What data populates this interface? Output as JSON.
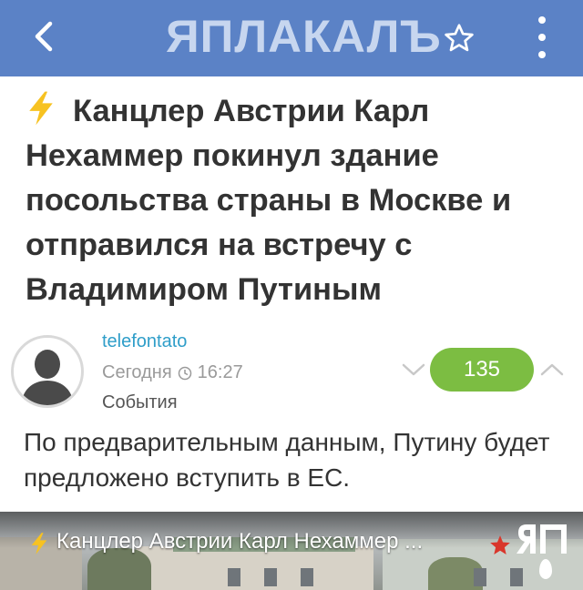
{
  "appbar": {
    "logo_text": "ЯПЛАКАЛЪ",
    "back_icon": "chevron-left-icon",
    "favorite_icon": "star-outline-icon",
    "menu_icon": "more-vertical-icon",
    "background_color": "#5b82c6"
  },
  "post": {
    "title": "Канцлер Австрии Карл Нехаммер покинул здание посольства страны в Москве и отправился на встречу с Владимиром Путиным",
    "author": "telefontato",
    "date": "Сегодня",
    "time": "16:27",
    "category": "События",
    "rating": "135",
    "rating_color": "#7cbd42",
    "body": "По предварительным данным, Путину будет предложено вступить в ЕС."
  },
  "media": {
    "title": "Канцлер Австрии Карл Нехаммер ..."
  }
}
